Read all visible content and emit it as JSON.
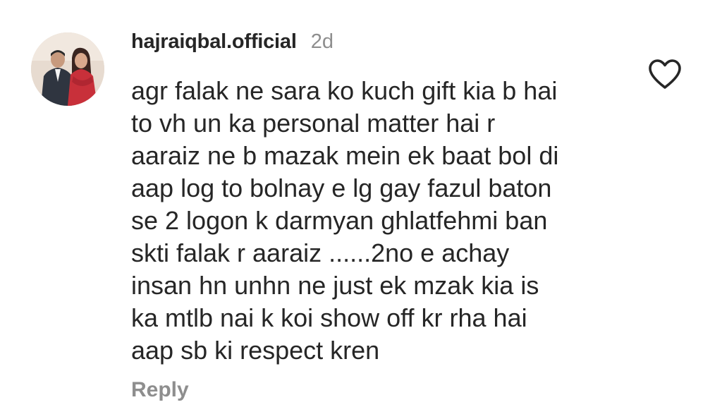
{
  "comment": {
    "username": "hajraiqbal.official",
    "timestamp": "2d",
    "lines": [
      "agr falak ne sara ko kuch gift kia b hai",
      "to vh un ka personal matter hai r",
      "aaraiz ne b mazak mein ek baat bol di",
      "aap log to bolnay e lg gay fazul baton",
      "se 2 logon k darmyan ghlatfehmi ban",
      "skti falak r aaraiz ......2no e achay",
      "insan hn unhn ne just ek mzak kia is",
      "ka mtlb nai k koi show off kr rha hai",
      "aap sb ki respect kren"
    ],
    "reply_label": "Reply",
    "like_icon": "heart-outline-icon"
  },
  "colors": {
    "text": "#262626",
    "muted": "#8e8e8e",
    "background": "#ffffff"
  }
}
